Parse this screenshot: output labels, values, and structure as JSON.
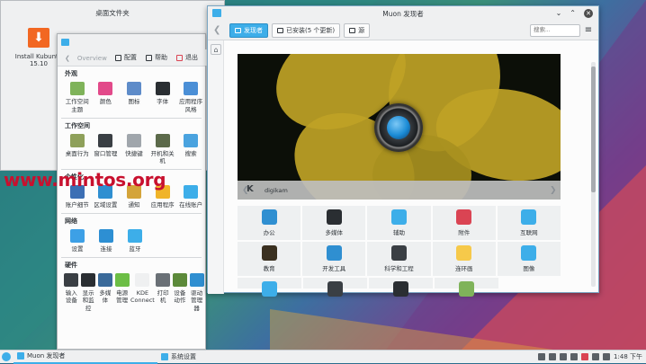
{
  "desktop": {
    "folder_title": "桌面文件夹",
    "installer_label": "Install Kubuntu 15.10",
    "watermark": "www.mintos.org"
  },
  "system_settings": {
    "back_label": "Overview",
    "toolbar": {
      "configure": "配置",
      "help": "帮助",
      "quit": "退出"
    },
    "categories": [
      {
        "title": "外观",
        "items": [
          {
            "label": "工作空间主题",
            "icon": "workspace-theme-icon",
            "color": "#7fb35a"
          },
          {
            "label": "颜色",
            "icon": "colors-icon",
            "color": "#e24a8a"
          },
          {
            "label": "图标",
            "icon": "icons-icon",
            "color": "#5e8cc9"
          },
          {
            "label": "字体",
            "icon": "fonts-icon",
            "color": "#2a2e32"
          },
          {
            "label": "应用程序风格",
            "icon": "app-style-icon",
            "color": "#4b8fd6"
          }
        ]
      },
      {
        "title": "工作空间",
        "items": [
          {
            "label": "桌面行为",
            "icon": "desktop-behavior-icon",
            "color": "#8ea05a"
          },
          {
            "label": "窗口管理",
            "icon": "window-management-icon",
            "color": "#3a3f44"
          },
          {
            "label": "快捷键",
            "icon": "shortcuts-icon",
            "color": "#a0a6ac"
          },
          {
            "label": "开机和关机",
            "icon": "startup-icon",
            "color": "#5c6a4a"
          },
          {
            "label": "搜索",
            "icon": "search-icon",
            "color": "#4aa3df"
          }
        ]
      },
      {
        "title": "个性化",
        "items": [
          {
            "label": "账户细节",
            "icon": "account-icon",
            "color": "#3c6fb4"
          },
          {
            "label": "区域设置",
            "icon": "locale-icon",
            "color": "#2f8fd1"
          },
          {
            "label": "通知",
            "icon": "notifications-icon",
            "color": "#d4a43a"
          },
          {
            "label": "应用程序",
            "icon": "applications-icon",
            "color": "#f0b429"
          },
          {
            "label": "在线账户",
            "icon": "online-accounts-icon",
            "color": "#3daee9"
          }
        ]
      },
      {
        "title": "网络",
        "items": [
          {
            "label": "设置",
            "icon": "network-settings-icon",
            "color": "#3da0e6"
          },
          {
            "label": "连接",
            "icon": "connections-icon",
            "color": "#2d8fd3"
          },
          {
            "label": "蓝牙",
            "icon": "bluetooth-icon",
            "color": "#3daee9"
          }
        ]
      },
      {
        "title": "硬件",
        "items": [
          {
            "label": "输入设备",
            "icon": "input-devices-icon",
            "color": "#3a3f44"
          },
          {
            "label": "显示和监控",
            "icon": "display-icon",
            "color": "#2a2e32"
          },
          {
            "label": "多媒体",
            "icon": "multimedia-icon",
            "color": "#3a6a9a"
          },
          {
            "label": "电源管理",
            "icon": "power-icon",
            "color": "#6cbe45"
          },
          {
            "label": "KDE Connect",
            "icon": "kde-connect-icon",
            "color": "#eff0f1"
          },
          {
            "label": "打印机",
            "icon": "printer-icon",
            "color": "#6a7076"
          },
          {
            "label": "设备动作",
            "icon": "device-actions-icon",
            "color": "#5c8a3a"
          },
          {
            "label": "驱动管理器",
            "icon": "driver-manager-icon",
            "color": "#2f8fd1"
          }
        ]
      }
    ]
  },
  "muon": {
    "title": "Muon 发现者",
    "tabs": [
      {
        "label": "发现者",
        "icon": "discover-icon",
        "active": true
      },
      {
        "label": "已安装(5 个更新)",
        "icon": "installed-icon",
        "active": false
      },
      {
        "label": "源",
        "icon": "sources-icon",
        "active": false
      }
    ],
    "search_placeholder": "搜索...",
    "banner_caption": "digikam",
    "categories": [
      [
        {
          "label": "办公",
          "icon": "office-icon",
          "color": "#2f8fd1"
        },
        {
          "label": "多媒体",
          "icon": "multimedia-icon",
          "color": "#2a2e32"
        },
        {
          "label": "辅助",
          "icon": "accessibility-icon",
          "color": "#3daee9"
        },
        {
          "label": "附件",
          "icon": "accessories-icon",
          "color": "#da4453"
        },
        {
          "label": "互联网",
          "icon": "internet-icon",
          "color": "#3daee9"
        }
      ],
      [
        {
          "label": "教育",
          "icon": "education-icon",
          "color": "#3a3020"
        },
        {
          "label": "开发工具",
          "icon": "development-icon",
          "color": "#2f8fd1"
        },
        {
          "label": "科学和工程",
          "icon": "science-icon",
          "color": "#3a3f44"
        },
        {
          "label": "连环画",
          "icon": "comics-icon",
          "color": "#f6c94a"
        },
        {
          "label": "图像",
          "icon": "graphics-icon",
          "color": "#3daee9"
        }
      ],
      [
        {
          "label": "",
          "icon": "more-icon",
          "color": "#3daee9"
        },
        {
          "label": "",
          "icon": "games-icon",
          "color": "#3a3f44"
        },
        {
          "label": "",
          "icon": "fonts-icon",
          "color": "#2a2e32"
        },
        {
          "label": "",
          "icon": "themes-icon",
          "color": "#7fb35a"
        }
      ]
    ]
  },
  "taskbar": {
    "apps": [
      {
        "label": "Muon 发现者",
        "active": true
      },
      {
        "label": "系统设置",
        "active": false
      }
    ],
    "clock": "1:48 下午"
  }
}
